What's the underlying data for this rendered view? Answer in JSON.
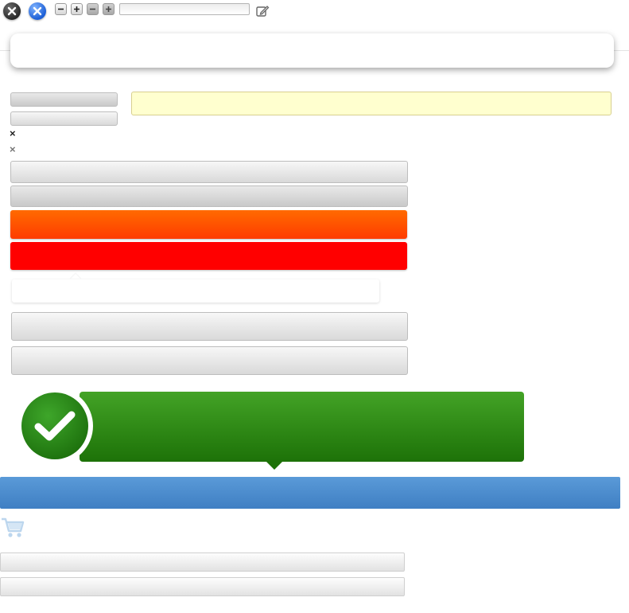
{
  "toolbar": {
    "icons": [
      "close-circle-icon",
      "close-circle-blue-icon",
      "minus-icon",
      "plus-icon",
      "minus-icon",
      "plus-icon",
      "edit-icon"
    ],
    "input": {
      "value": "",
      "placeholder": ""
    }
  },
  "popup": {
    "text": ""
  },
  "form": {
    "buttons": [
      "",
      ""
    ],
    "yellow_field": {
      "value": "",
      "placeholder": ""
    }
  },
  "tooltip": {
    "text": ""
  },
  "success_banner": {
    "text": "",
    "icon": "check-icon"
  },
  "info_bar": {
    "text": ""
  },
  "cart": {
    "icon": "cart-icon"
  },
  "colors": {
    "orange": "#ff4f00",
    "red": "#ff0000",
    "green": "#2e8b16",
    "blue": "#4a8ccf",
    "yellow_field": "#ffffcf"
  }
}
